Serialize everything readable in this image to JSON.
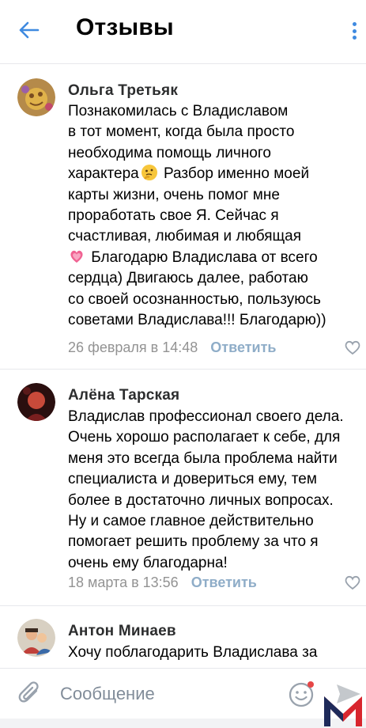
{
  "header": {
    "title": "Отзывы",
    "back_icon": "arrow-left-icon",
    "more_icon": "more-vertical-icon",
    "accent_color": "#3f8ae0"
  },
  "comments": [
    {
      "author": "Ольга Третьяк",
      "text_parts": [
        "Познакомилась с Владиславом\nв тот момент, когда была просто\nнеобходима помощь личного\nхарактера",
        " Разбор именно моей\nкарты жизни, очень помог мне\nпроработать свое Я. Сейчас я\nсчастливая, любимая и любящая\n",
        " Благодарю Владислава от всего\nсердца) Двигаюсь далее, работаю\nсо своей осознанностью, пользуюсь\nсоветами Владислава!!! Благодарю))"
      ],
      "emojis": [
        "thinking-face-emoji",
        "growing-heart-emoji"
      ],
      "date": "26 февраля в 14:48",
      "reply": "Ответить"
    },
    {
      "author": "Алёна Тарская",
      "text": "Владислав профессионал своего дела.\nОчень хорошо располагает к себе, для\nменя это всегда была проблема найти\nспециалиста и довериться ему, тем\nболее в достаточно личных вопросах.\nНу и самое главное действительно\nпомогает решить проблему за что я\nочень ему благодарна!",
      "date": "18 марта в 13:56",
      "reply": "Ответить"
    },
    {
      "author": "Антон Минаев",
      "text": "Хочу поблагодарить Владислава за"
    }
  ],
  "composer": {
    "placeholder": "Сообщение",
    "attach_icon": "paperclip-icon",
    "emoji_icon": "smile-icon",
    "send_icon": "send-icon"
  },
  "colors": {
    "meta": "#939393",
    "reply": "#8fadc8",
    "divider": "#e7e8ec"
  }
}
